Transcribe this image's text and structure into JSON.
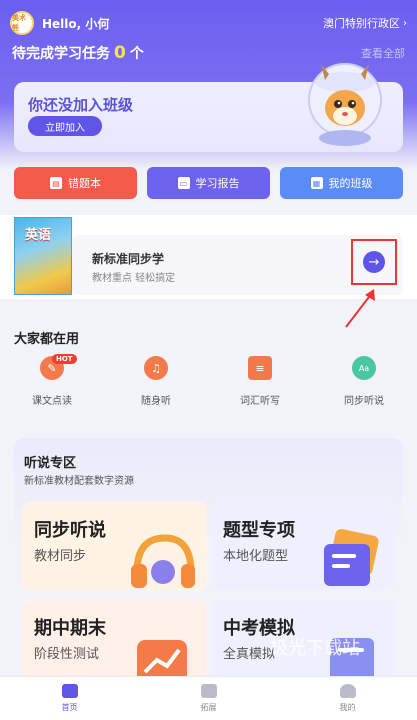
{
  "header": {
    "avatar_text": "美术熊",
    "greeting": "Hello, 小何",
    "region": "澳门特别行政区",
    "region_chevron": "›",
    "task_label": "待完成学习任务",
    "task_count": "0",
    "task_unit": "个",
    "view_all": "查看全部"
  },
  "class_card": {
    "title": "你还没加入班级",
    "join_button": "立即加入"
  },
  "quick_actions": [
    {
      "label": "错题本",
      "icon": "notebook-icon",
      "color": "#f45b4b"
    },
    {
      "label": "学习报告",
      "icon": "report-icon",
      "color": "#6d63ee"
    },
    {
      "label": "我的班级",
      "icon": "class-icon",
      "color": "#5b8cf5"
    }
  ],
  "sync": {
    "book_cover": "英语",
    "title": "新标准同步学",
    "subtitle": "教材重点 轻松搞定",
    "arrow": "→"
  },
  "popular": {
    "title": "大家都在用",
    "hot_badge": "HOT",
    "items": [
      {
        "label": "课文点读",
        "icon": "pen-icon",
        "color": "#f2794a",
        "glyph": "✎"
      },
      {
        "label": "随身听",
        "icon": "headphones-icon",
        "color": "#f2794a",
        "glyph": "♫"
      },
      {
        "label": "词汇听写",
        "icon": "document-icon",
        "color": "#f2794a",
        "glyph": "≡"
      },
      {
        "label": "同步听说",
        "icon": "speech-icon",
        "color": "#4ac7a0",
        "glyph": "Aa"
      }
    ]
  },
  "listening": {
    "title": "听说专区",
    "subtitle": "新标准教材配套数字资源",
    "tiles": [
      {
        "title": "同步听说",
        "subtitle": "教材同步",
        "bg": "#fff3e6"
      },
      {
        "title": "题型专项",
        "subtitle": "本地化题型",
        "bg": "#eef1fd"
      },
      {
        "title": "期中期末",
        "subtitle": "阶段性测试",
        "bg": "#fff0ea"
      },
      {
        "title": "中考模拟",
        "subtitle": "全真模拟",
        "bg": "#eef1fd"
      }
    ]
  },
  "watermark": "极光下载站",
  "nav": [
    {
      "label": "首页",
      "active": true
    },
    {
      "label": "拓展",
      "active": false
    },
    {
      "label": "我的",
      "active": false
    }
  ]
}
